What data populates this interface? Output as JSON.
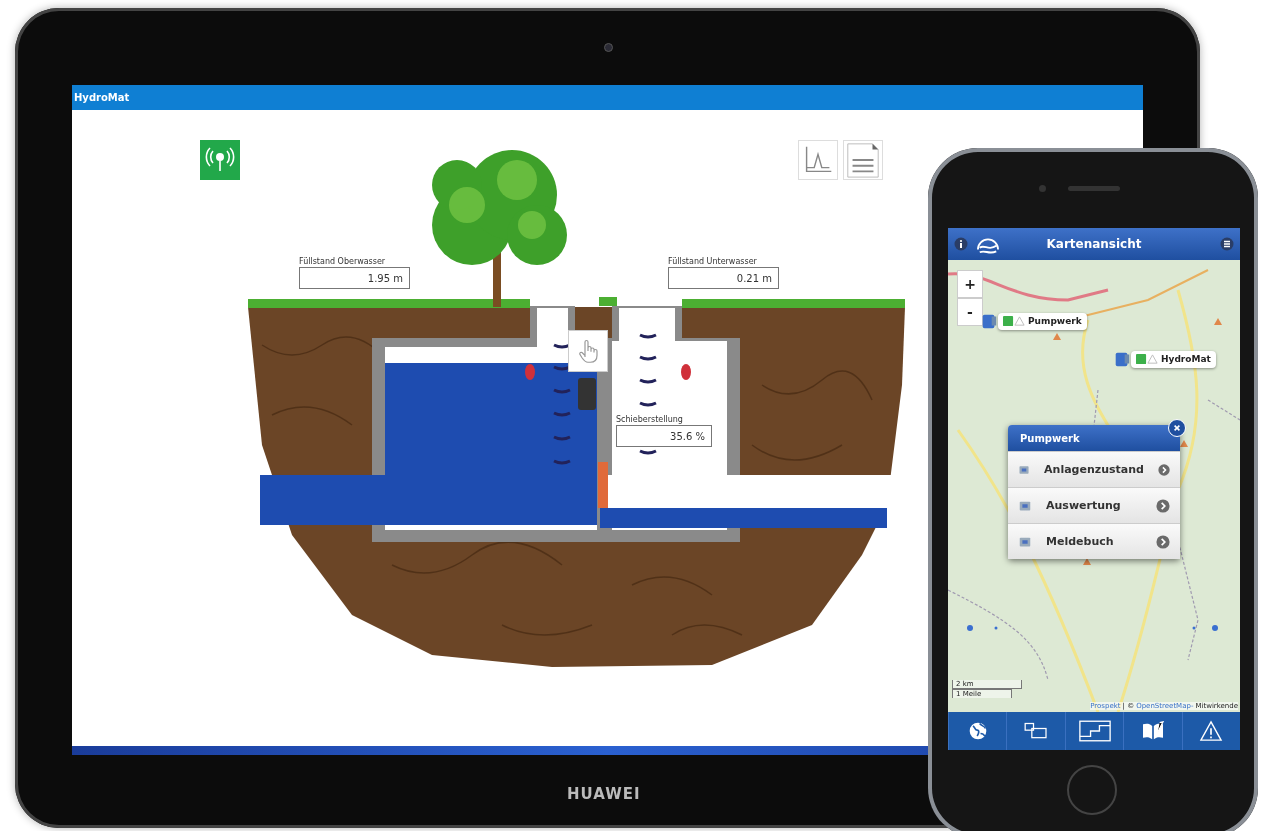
{
  "tablet": {
    "brand": "HUAWEI",
    "app": {
      "title": "HydroMat",
      "readings": [
        {
          "label": "Füllstand Oberwasser",
          "value": "1.95 m"
        },
        {
          "label": "Füllstand Unterwasser",
          "value": "0.21 m"
        },
        {
          "label": "Schieberstellung",
          "value": "35.6 %"
        }
      ]
    }
  },
  "phone": {
    "header": {
      "title": "Kartenansicht"
    },
    "map": {
      "zoom_controls": [
        "+",
        "-"
      ],
      "markers": [
        {
          "label": "Pumpwerk"
        },
        {
          "label": "HydroMat"
        }
      ],
      "popup": {
        "title": "Pumpwerk",
        "items": [
          {
            "label": "Anlagenzustand"
          },
          {
            "label": "Auswertung"
          },
          {
            "label": "Meldebuch"
          }
        ]
      },
      "scale": [
        "2 km",
        "1 Meile"
      ],
      "attribution": {
        "link_1": "Prospekt",
        "separator": "| ©",
        "link_2": "OpenStreetMap-",
        "text": "Mitwirkende"
      }
    }
  }
}
